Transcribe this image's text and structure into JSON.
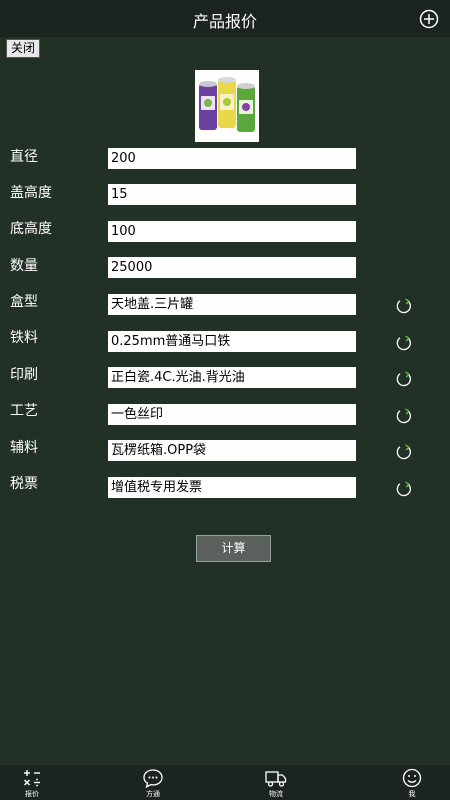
{
  "header": {
    "title": "产品报价",
    "add_icon": "plus-circle-icon"
  },
  "close_label": "关闭",
  "product_image": "printed tin cans (three cylinders)",
  "fields": [
    {
      "label": "直径",
      "value": "200"
    },
    {
      "label": "盖高度",
      "value": "15"
    },
    {
      "label": "底高度",
      "value": "100"
    },
    {
      "label": "数量",
      "value": "25000"
    },
    {
      "label": "盒型",
      "value": "天地盖.三片罐",
      "has_refresh": true
    },
    {
      "label": "铁料",
      "value": "0.25mm普通马口铁",
      "has_refresh": true
    },
    {
      "label": "印刷",
      "value": "正白瓷.4C.光油.背光油",
      "has_refresh": true
    },
    {
      "label": "工艺",
      "value": "一色丝印",
      "has_refresh": true
    },
    {
      "label": "辅料",
      "value": "瓦楞纸箱.OPP袋",
      "has_refresh": true
    },
    {
      "label": "税票",
      "value": "增值税专用发票",
      "has_refresh": true
    }
  ],
  "calculate_label": "计算",
  "tabs": [
    {
      "label": "报价",
      "icon": "calculator-icon"
    },
    {
      "label": "方通",
      "icon": "chat-icon"
    },
    {
      "label": "物流",
      "icon": "truck-icon"
    },
    {
      "label": "我",
      "icon": "user-icon"
    }
  ]
}
